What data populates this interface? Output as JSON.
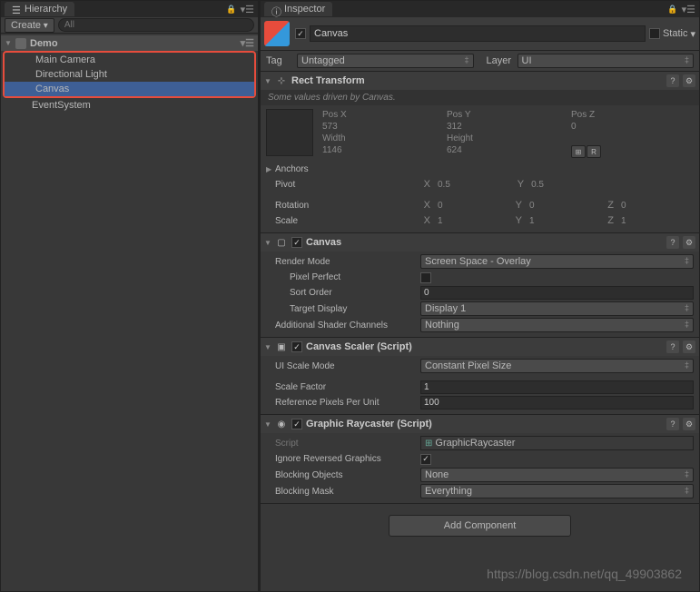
{
  "hierarchy": {
    "tab": "Hierarchy",
    "create": "Create",
    "search_placeholder": "All",
    "root": "Demo",
    "items": [
      "Main Camera",
      "Directional Light",
      "Canvas",
      "EventSystem"
    ],
    "selected": "Canvas"
  },
  "inspector": {
    "tab": "Inspector",
    "name": "Canvas",
    "static_label": "Static",
    "tag_label": "Tag",
    "tag_value": "Untagged",
    "layer_label": "Layer",
    "layer_value": "UI"
  },
  "rect": {
    "title": "Rect Transform",
    "driven": "Some values driven by Canvas.",
    "posx_l": "Pos X",
    "posy_l": "Pos Y",
    "posz_l": "Pos Z",
    "posx": "573",
    "posy": "312",
    "posz": "0",
    "w_l": "Width",
    "h_l": "Height",
    "w": "1146",
    "h": "624",
    "anchors": "Anchors",
    "pivot": "Pivot",
    "pivx": "0.5",
    "pivy": "0.5",
    "rotation": "Rotation",
    "rx": "0",
    "ry": "0",
    "rz": "0",
    "scale": "Scale",
    "sx": "1",
    "sy": "1",
    "sz": "1"
  },
  "canvas": {
    "title": "Canvas",
    "render_mode_l": "Render Mode",
    "render_mode": "Screen Space - Overlay",
    "pixel_perfect_l": "Pixel Perfect",
    "sort_order_l": "Sort Order",
    "sort_order": "0",
    "target_display_l": "Target Display",
    "target_display": "Display 1",
    "addl_shader_l": "Additional Shader Channels",
    "addl_shader": "Nothing"
  },
  "scaler": {
    "title": "Canvas Scaler (Script)",
    "ui_scale_l": "UI Scale Mode",
    "ui_scale": "Constant Pixel Size",
    "scale_factor_l": "Scale Factor",
    "scale_factor": "1",
    "ref_px_l": "Reference Pixels Per Unit",
    "ref_px": "100"
  },
  "raycaster": {
    "title": "Graphic Raycaster (Script)",
    "script_l": "Script",
    "script": "GraphicRaycaster",
    "ignore_l": "Ignore Reversed Graphics",
    "blocking_obj_l": "Blocking Objects",
    "blocking_obj": "None",
    "blocking_mask_l": "Blocking Mask",
    "blocking_mask": "Everything"
  },
  "add_component": "Add Component",
  "watermark": "https://blog.csdn.net/qq_49903862"
}
